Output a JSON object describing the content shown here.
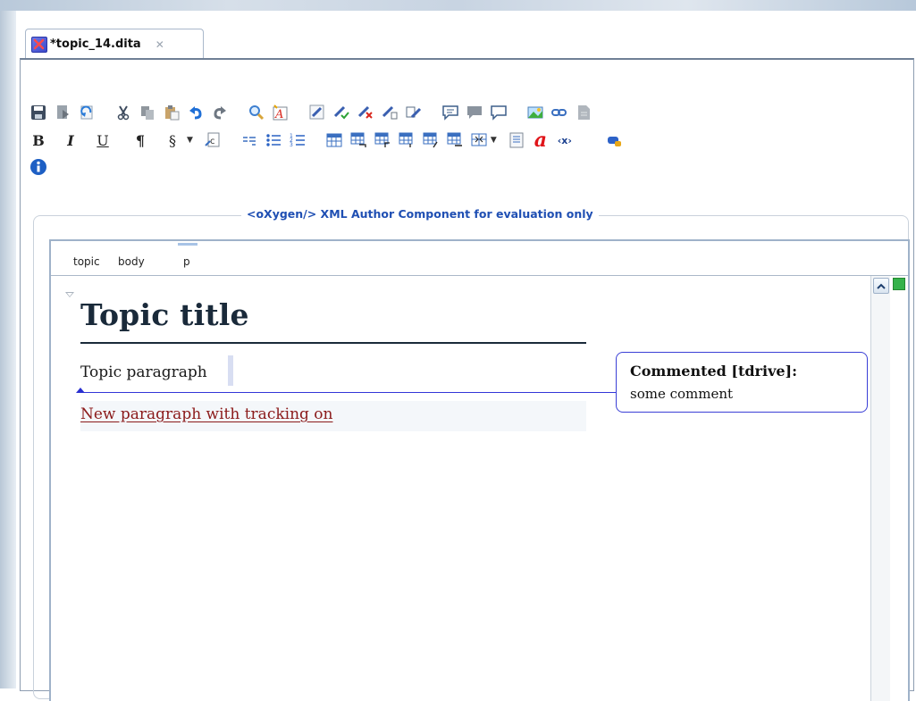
{
  "tab": {
    "title": "*topic_14.dita",
    "close_glyph": "✕"
  },
  "toolbar": {
    "row1": [
      "save-icon",
      "save-all-icon",
      "revert-icon",
      "cut-icon",
      "copy-icon",
      "paste-icon",
      "undo-icon",
      "redo-icon",
      "find-icon",
      "spellcheck-icon",
      "track-changes-icon",
      "accept-change-icon",
      "reject-change-icon",
      "comment-change-icon",
      "edit-comment-icon",
      "add-comment-icon",
      "remove-comment-icon",
      "manage-comments-icon",
      "insert-image-icon",
      "insert-link-icon",
      "insert-file-icon"
    ],
    "row2_text": {
      "bold": "B",
      "italic": "I",
      "underline": "U",
      "pilcrow": "¶",
      "section": "§"
    },
    "info_icon": "info-icon"
  },
  "banner": "<oXygen/> XML Author Component for evaluation only",
  "breadcrumb": [
    "topic",
    "body",
    "p"
  ],
  "document": {
    "title": "Topic title",
    "paragraph": "Topic paragraph",
    "tracked_paragraph": "New paragraph with tracking on"
  },
  "comment": {
    "author": "Commented [tdrive]:",
    "text": "some comment"
  },
  "colors": {
    "banner": "#1f4fb3",
    "tracked_text": "#8b1a1a",
    "comment_border": "#3a3fd6",
    "overview_marker": "#35b24a"
  }
}
